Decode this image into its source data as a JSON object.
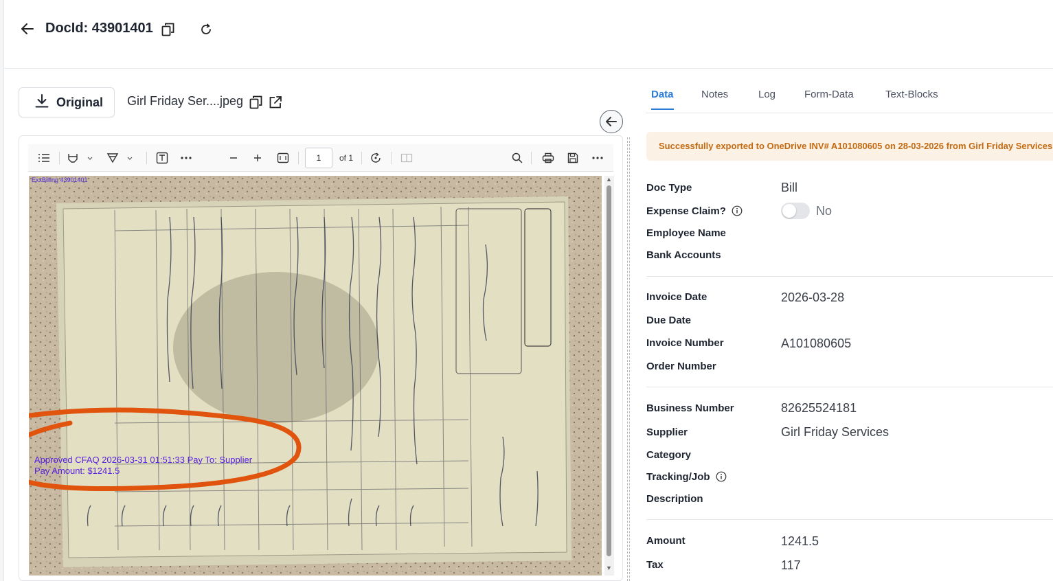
{
  "header": {
    "title": "DocId: 43901401"
  },
  "toolbar": {
    "original_label": "Original",
    "file_name": "Girl Friday Ser....jpeg"
  },
  "pdf": {
    "page_current": "1",
    "page_total": "of 1",
    "stamp_top": "ExxBilling 43901401",
    "approved_line1": "Approved CFAQ 2026-03-31 01:51:33 Pay To: Supplier",
    "approved_line2": "Pay Amount: $1241.5"
  },
  "tabs": [
    "Data",
    "Notes",
    "Log",
    "Form-Data",
    "Text-Blocks"
  ],
  "banner": "Successfully exported to OneDrive INV# A101080605 on 28-03-2026 from Girl Friday Services",
  "fields": {
    "doc_type_label": "Doc Type",
    "doc_type_value": "Bill",
    "expense_claim_label": "Expense Claim?",
    "expense_claim_value": "No",
    "employee_name_label": "Employee Name",
    "bank_accounts_label": "Bank Accounts",
    "invoice_date_label": "Invoice Date",
    "invoice_date_value": "2026-03-28",
    "due_date_label": "Due Date",
    "invoice_number_label": "Invoice Number",
    "invoice_number_value": "A101080605",
    "order_number_label": "Order Number",
    "business_number_label": "Business Number",
    "business_number_value": "82625524181",
    "supplier_label": "Supplier",
    "supplier_value": "Girl Friday Services",
    "category_label": "Category",
    "tracking_label": "Tracking/Job",
    "description_label": "Description",
    "amount_label": "Amount",
    "amount_value": "1241.5",
    "tax_label": "Tax",
    "tax_value": "117"
  },
  "colors": {
    "accent": "#2a7bd6",
    "banner_bg": "#fbf1e4",
    "banner_text": "#c46a12",
    "stamp": "#5a21e0"
  }
}
